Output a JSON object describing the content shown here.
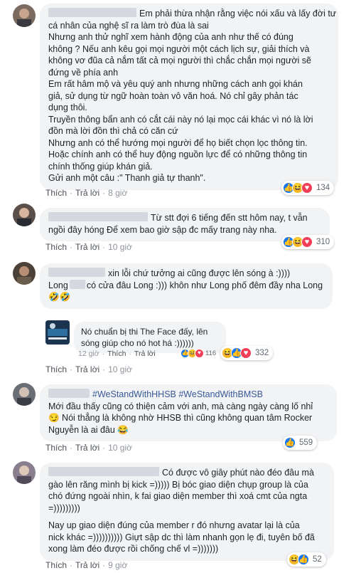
{
  "comments": [
    {
      "lines": [
        "Em phải thừa nhận rằng việc nói xấu và lấy đời tư",
        "cá nhân của nghệ sĩ ra làm trò đùa là sai",
        "Nhưng anh thử nghĩ xem hành động của anh như thế có đúng",
        "không ? Nếu anh kêu gọi mọi người một cách lịch sự, giải thích và",
        "không vơ đũa cả nắm tất cả mọi người thì chắc chắn mọi người sẽ",
        "đứng về phía anh",
        "Em rất hâm mộ và yêu quý anh nhưng những cách anh gọi khán",
        "giả, sử dụng từ ngữ hoàn toàn vô văn hoá. Nó chỉ gây phản tác",
        "dụng thôi.",
        "Truyền thông bẩn anh có cắt cái này nó lại mọc cái khác vì nó là lời",
        "đồn mà lời đồn thì chả có căn cứ",
        "Nhưng anh có thể hướng mọi người để họ biết chọn lọc thông tin.",
        "Hoặc chính anh có thể huy động nguồn lực để có những thông tin",
        "chính thống giúp khán giả.",
        "Gửi anh một câu :\" Thanh giả tự thanh\"."
      ],
      "like": "Thích",
      "reply": "Trả lời",
      "time": "8 giờ",
      "reactions": "134"
    },
    {
      "lines": [
        "Từ stt đợi 6 tiếng đến stt hôm nay, t vẫn",
        "ngồi đây hóng Để xem bao giờ sập đc mấy trang này nha."
      ],
      "like": "Thích",
      "reply": "Trả lời",
      "time": "10 giờ",
      "reactions": "310"
    },
    {
      "line1": "xin lỗi chứ tưởng ai cũng được lên sóng à :))))",
      "line2_a": "Long",
      "line2_b": "có cửa đâu Long :))) khôn như Long phố đêm đầy nha Long",
      "emoji_row": "🤣🤣",
      "reply_text_1": "Nó chuẩn bị thi The Face đấy, lên",
      "reply_text_2": "sóng giúp cho nó hot há :))))))",
      "reply_time": "12 giờ",
      "reply_like": "Thích",
      "reply_reply": "Trả lời",
      "reply_reactions": "116",
      "like": "Thích",
      "reply": "Trả lời",
      "time": "10 giờ",
      "reactions": "332"
    },
    {
      "hashtag1": "#WeStandWithHHSB",
      "hashtag2": "#WeStandWithBMSB",
      "lines": [
        "Mới đầu thấy cũng có thiện cảm với anh, mà càng ngày càng lố nhỉ",
        "😏 Nói thẳng là không nhờ HHSB thì cũng không quan tâm Rocker",
        "Nguyễn là ai đâu 😂"
      ],
      "like": "Thích",
      "reply": "Trả lời",
      "time": "10 giờ",
      "reactions": "559"
    },
    {
      "lines": [
        "Có được vô giây phút nào đéo đâu mà",
        "gào lên răng mình bị kick =))))) Bị bóc giao diện chụp group là của",
        "chó đứng ngoài nhìn, k fai giao diện member thì xoá cmt của ngta",
        "=)))))))))",
        "",
        "Nay up giao diện đúng của member r đó nhưng avatar lại là của",
        "nick khác =)))))))))) Giựt sập dc thì làm nhanh gọn lẹ đi, tuyên bố đã",
        "xong làm đéo được rồi chống chế vl =)))))))"
      ],
      "like": "Thích",
      "reply": "Trả lời",
      "time": "9 giờ",
      "reactions": "52"
    }
  ],
  "colors": {
    "bubble": "#f2f3f5",
    "link": "#385898",
    "meta": "#90949c",
    "like": "#1877f2",
    "haha": "#f7b928",
    "love": "#f33e58"
  }
}
